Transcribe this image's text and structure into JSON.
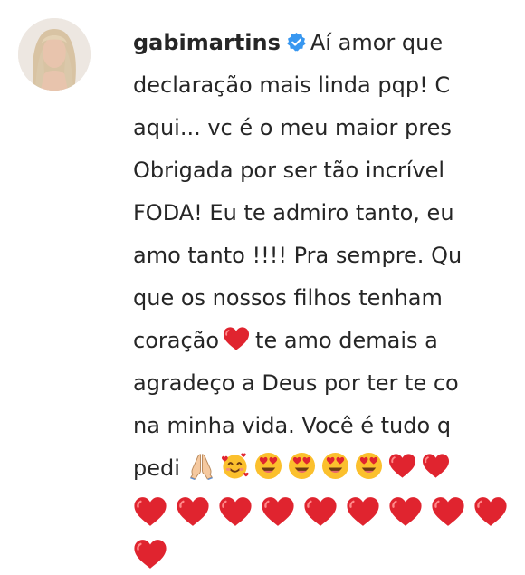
{
  "comment": {
    "username": "gabimartins",
    "verified_icon": "verified-badge-icon",
    "lines": [
      "Aí amor que",
      "declaração mais linda pqp! C",
      "aqui... vc é o meu maior pres",
      "Obrigada por ser tão incrível",
      "FODA! Eu te admiro tanto, eu",
      "amo tanto !!!! Pra sempre. Qu",
      "que os nossos filhos tenham"
    ],
    "line8_before": "coração",
    "line8_after": "te amo demais a",
    "line9": "agradeço a Deus por ter te co",
    "line10": "na minha vida. Você é tudo q",
    "line11_text": "pedi",
    "emojis": [
      "folded-hands-icon",
      "smiling-face-with-hearts-icon",
      "heart-eyes-icon",
      "heart-eyes-icon",
      "heart-eyes-icon",
      "heart-eyes-icon",
      "red-heart-icon",
      "red-heart-icon"
    ],
    "heart_color": "#e0242f"
  }
}
